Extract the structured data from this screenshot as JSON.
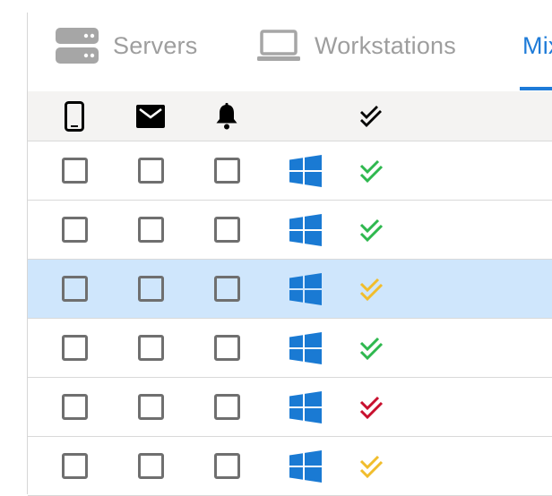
{
  "tabs": [
    {
      "label": "Servers",
      "icon": "server-icon",
      "active": false
    },
    {
      "label": "Workstations",
      "icon": "laptop-icon",
      "active": false
    },
    {
      "label": "Mix",
      "active": true
    }
  ],
  "table": {
    "header_icons": [
      "mobile-phone-icon",
      "mail-icon",
      "bell-icon",
      "double-check-icon"
    ],
    "rows": [
      {
        "os": "windows-icon",
        "status": "ok",
        "selected": false
      },
      {
        "os": "windows-icon",
        "status": "ok",
        "selected": false
      },
      {
        "os": "windows-icon",
        "status": "warning",
        "selected": true
      },
      {
        "os": "windows-icon",
        "status": "ok",
        "selected": false
      },
      {
        "os": "windows-icon",
        "status": "error",
        "selected": false
      },
      {
        "os": "windows-icon",
        "status": "warning",
        "selected": false
      }
    ]
  },
  "colors": {
    "accent": "#1e7bd8",
    "status_ok": "#2fb84f",
    "status_warning": "#f1bd2c",
    "status_error": "#c8102e",
    "windows": "#1a7ad3",
    "selected_row": "#cfe6fc",
    "header_bg": "#f4f3f2"
  }
}
